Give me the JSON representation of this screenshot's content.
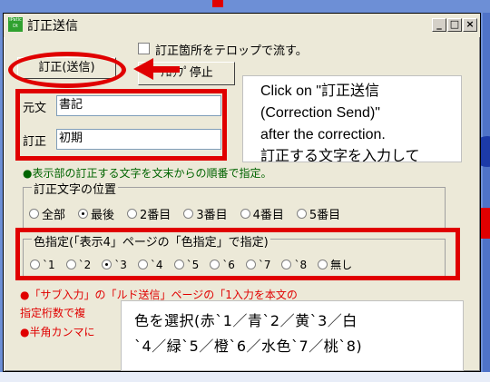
{
  "window": {
    "icon_text": "IPatic Dt",
    "title": "訂正送信",
    "controls": {
      "minimize": "_",
      "maximize": "□",
      "close": "×"
    }
  },
  "scroll_checkbox": {
    "label": "訂正箇所をテロップで流す。",
    "checked": false
  },
  "buttons": {
    "send": "訂正(送信)",
    "stop": "ﾃﾛｯﾌﾟ停止"
  },
  "fields": {
    "original_label": "元文",
    "original_value": "書記",
    "correction_label": "訂正",
    "correction_value": "初期"
  },
  "tooltip_en": {
    "lines": [
      "Click on \"訂正送信",
      "(Correction Send)\"",
      "after the correction.",
      "訂正する文字を入力して"
    ]
  },
  "instruction": "●表示部の訂正する文字を文末からの順番で指定。",
  "position_group": {
    "title": "訂正文字の位置",
    "options": [
      "全部",
      "最後",
      "2番目",
      "3番目",
      "4番目",
      "5番目"
    ],
    "selected": "最後"
  },
  "color_group": {
    "title": "色指定(「表示4」ページの「色指定」で指定)",
    "options": [
      "`1",
      "`2",
      "`3",
      "`4",
      "`5",
      "`6",
      "`7",
      "`8",
      "無し"
    ],
    "selected": "`3"
  },
  "notes": [
    "●「サブ入力」の「ルド送信」ページの「1入力を本文の",
    "指定桁数で複",
    "●半角カンマに"
  ],
  "tooltip_jp": {
    "lines": [
      "色を選択(赤`1／青`2／黄`3／白",
      "`4／緑`5／橙`6／水色`7／桃`8)"
    ]
  },
  "colors": {
    "annotation_red": "#e00000",
    "instruction_green": "#006400",
    "background_blue": "#6d8fd6",
    "window_face": "#ece9d8"
  }
}
